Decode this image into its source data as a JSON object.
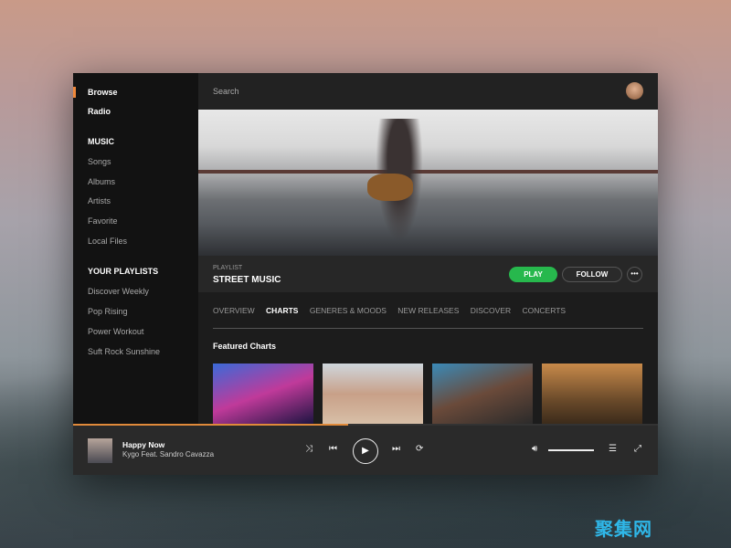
{
  "sidebar": {
    "browse": "Browse",
    "radio": "Radio",
    "music_heading": "MUSIC",
    "music": [
      "Songs",
      "Albums",
      "Artists",
      "Favorite",
      "Local Files"
    ],
    "playlists_heading": "YOUR PLAYLISTS",
    "playlists": [
      "Discover Weekly",
      "Pop Rising",
      "Power Workout",
      "Suft Rock Sunshine"
    ]
  },
  "header": {
    "search_placeholder": "Search"
  },
  "hero": {
    "kicker": "PLAYLIST",
    "title": "STREET MUSIC",
    "play": "PLAY",
    "follow": "FOLLOW",
    "more": "•••"
  },
  "tabs": [
    {
      "label": "OVERVIEW"
    },
    {
      "label": "CHARTS",
      "active": true
    },
    {
      "label": "GENERES & MOODS"
    },
    {
      "label": "NEW RELEASES"
    },
    {
      "label": "DISCOVER"
    },
    {
      "label": "CONCERTS"
    }
  ],
  "featured": {
    "title": "Featured Charts"
  },
  "player": {
    "title": "Happy Now",
    "artist": "Kygo Feat. Sandro Cavazza",
    "progress_percent": 47,
    "volume_percent": 100
  },
  "colors": {
    "accent": "#f0883a",
    "play_green": "#27b84d"
  },
  "watermark": "聚集网"
}
